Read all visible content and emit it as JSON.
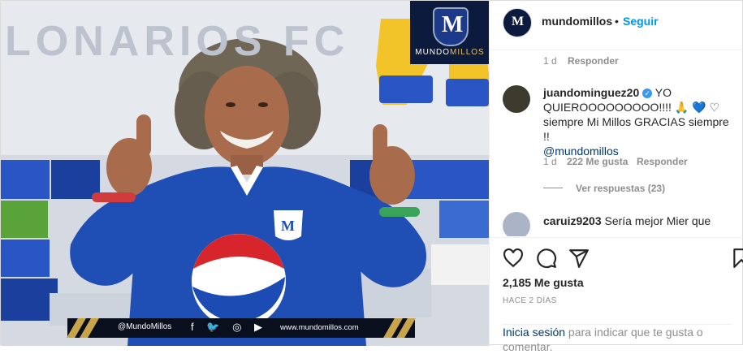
{
  "post": {
    "image": {
      "wall_text": "LONARIOS FC",
      "logo": {
        "letter": "M",
        "text_white": "MUNDO",
        "text_gold": "MILLOS"
      },
      "banner": {
        "handle": "@MundoMillos",
        "icons": [
          "facebook-icon",
          "twitter-icon",
          "instagram-icon",
          "youtube-icon"
        ],
        "url": "www.mundomillos.com"
      }
    }
  },
  "header": {
    "username": "mundomillos",
    "separator": "•",
    "follow_label": "Seguir",
    "avatar_letter": "M"
  },
  "comments": {
    "first_meta": {
      "time": "1 d",
      "reply": "Responder"
    },
    "juan": {
      "username": "juandominguez20",
      "text_line1": "YO",
      "text_line2": "QUIEROOOOOOOOO!!!! 🙏",
      "heart_blue": "💙",
      "heart_white": "♡",
      "text_line3": "siempre Mi Millos GRACIAS siempre !!",
      "mention": "@mundomillos",
      "time": "1 d",
      "likes": "222 Me gusta",
      "reply": "Responder",
      "view_replies": "Ver respuestas (23)"
    },
    "caru": {
      "username": "caruiz9203",
      "text": "Sería mejor Mier que"
    }
  },
  "actions": {
    "likes": "2,185 Me gusta",
    "time_ago": "HACE 2 DÍAS",
    "login_link": "Inicia sesión",
    "login_text": " para indicar que te gusta o comentar."
  },
  "colors": {
    "link_blue": "#0095f6",
    "mention_blue": "#00376b",
    "muted": "#8e8e8e",
    "text": "#262626",
    "jersey_blue": "#1f4fb5"
  }
}
